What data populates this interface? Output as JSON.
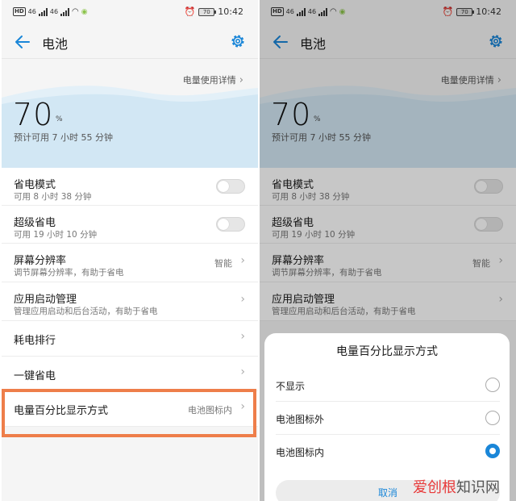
{
  "status_bar": {
    "time": "10:42",
    "battery_level": "70",
    "network_1": "46",
    "network_2": "46"
  },
  "header": {
    "title": "电池"
  },
  "battery": {
    "usage_link": "电量使用详情",
    "percent": "70",
    "percent_unit": "%",
    "estimate": "预计可用 7 小时 55 分钟"
  },
  "settings": {
    "power_saving": {
      "title": "省电模式",
      "subtitle": "可用 8 小时 38 分钟"
    },
    "super_saving": {
      "title": "超级省电",
      "subtitle": "可用 19 小时 10 分钟"
    },
    "resolution": {
      "title": "屏幕分辨率",
      "subtitle": "调节屏幕分辨率，有助于省电",
      "value": "智能"
    },
    "app_launch": {
      "title": "应用启动管理",
      "subtitle": "管理应用启动和后台活动，有助于省电"
    },
    "consumption_rank": {
      "title": "耗电排行"
    },
    "one_key": {
      "title": "一键省电"
    },
    "percent_display": {
      "title": "电量百分比显示方式",
      "value": "电池图标内"
    }
  },
  "dialog": {
    "title": "电量百分比显示方式",
    "options": [
      {
        "label": "不显示",
        "checked": false
      },
      {
        "label": "电池图标外",
        "checked": false
      },
      {
        "label": "电池图标内",
        "checked": true
      }
    ],
    "cancel_label": "取消"
  },
  "watermark": {
    "red_part": "爱创根",
    "gray_part": "知识网"
  },
  "colors": {
    "accent": "#1a86d8",
    "highlight": "#ee7e4a",
    "wave": "#d2e7f4"
  }
}
